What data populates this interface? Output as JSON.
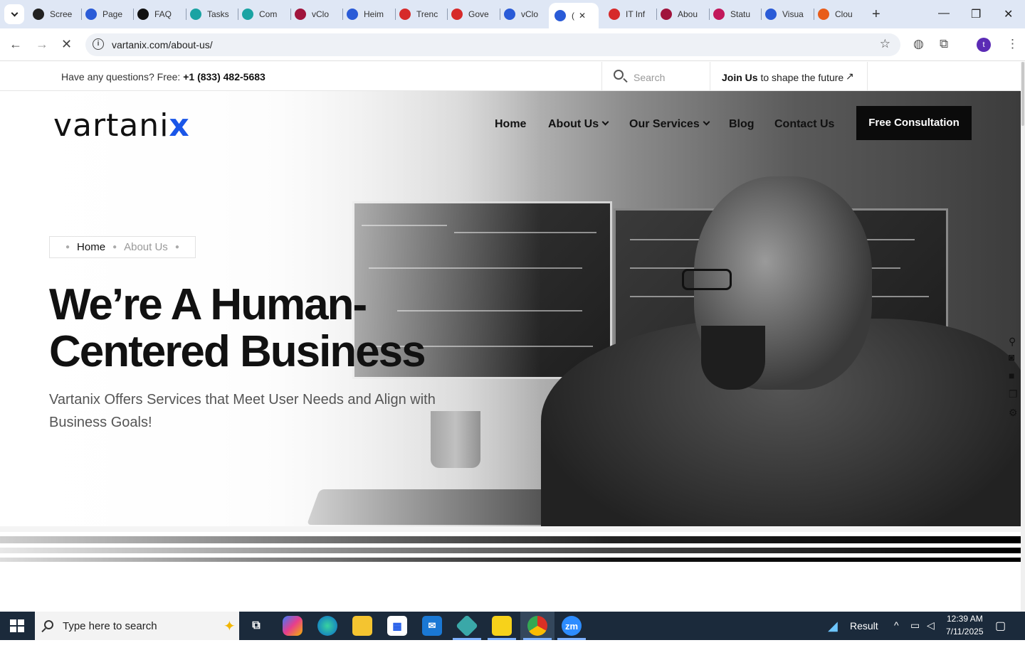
{
  "browser": {
    "tabs": [
      {
        "label": "Scree",
        "color": "#222222",
        "glyph": "screen-icon"
      },
      {
        "label": "Page",
        "color": "#2a5bd7",
        "glyph": "gauge-icon"
      },
      {
        "label": "FAQ",
        "color": "#111111",
        "glyph": "openai-icon"
      },
      {
        "label": "Tasks",
        "color": "#1aa3a3",
        "glyph": "hex-icon"
      },
      {
        "label": "Com",
        "color": "#1aa3a3",
        "glyph": "hex-icon"
      },
      {
        "label": "vClo",
        "color": "#a0143c",
        "glyph": "v-icon"
      },
      {
        "label": "Heim",
        "color": "#2a5bd7",
        "glyph": "scale-icon"
      },
      {
        "label": "Trenc",
        "color": "#d62a2a",
        "glyph": "shield-icon"
      },
      {
        "label": "Gove",
        "color": "#d62a2a",
        "glyph": "shield-icon"
      },
      {
        "label": "vClo",
        "color": "#2a5bd7",
        "glyph": "check-icon"
      },
      {
        "label": "(",
        "color": "#2a5bd7",
        "glyph": "loading-icon",
        "active": true
      },
      {
        "label": "IT Inf",
        "color": "#d62a2a",
        "glyph": "shield-icon"
      },
      {
        "label": "Abou",
        "color": "#a0143c",
        "glyph": "gem-icon"
      },
      {
        "label": "Statu",
        "color": "#c2185b",
        "glyph": "bolt-icon"
      },
      {
        "label": "Visua",
        "color": "#2a5bd7",
        "glyph": "pulse-icon"
      },
      {
        "label": "Clou",
        "color": "#e85d1a",
        "glyph": "slash-icon"
      }
    ],
    "url": "vartanix.com/about-us/",
    "profile_initial": "t"
  },
  "site": {
    "topbar": {
      "question_prefix": "Have any questions? Free: ",
      "phone": "+1 (833) 482-5683",
      "search_placeholder": "Search",
      "join_bold": "Join Us",
      "join_rest": " to shape the future",
      "join_arrow": "↗"
    },
    "logo": {
      "main": "vartani",
      "accent": "x"
    },
    "nav": [
      {
        "label": "Home",
        "dropdown": false
      },
      {
        "label": "About Us",
        "dropdown": true
      },
      {
        "label": "Our Services",
        "dropdown": true
      },
      {
        "label": "Blog",
        "dropdown": false
      },
      {
        "label": "Contact Us",
        "dropdown": false
      }
    ],
    "cta": "Free Consultation",
    "breadcrumb": {
      "current": "Home",
      "page": "About Us"
    },
    "headline": "We’re A Human-Centered Business",
    "subheadline": "Vartanix Offers Services that Meet User Needs and Align with Business Goals!"
  },
  "taskbar": {
    "search_placeholder": "Type here to search",
    "apps": [
      "task-view",
      "copilot",
      "edge",
      "file-explorer",
      "store",
      "mail",
      "hex-app",
      "sticky-notes",
      "chrome",
      "zoom"
    ],
    "zoom_label": "zm",
    "weather": "Result",
    "time": "12:39 AM",
    "date": "7/11/2025"
  }
}
